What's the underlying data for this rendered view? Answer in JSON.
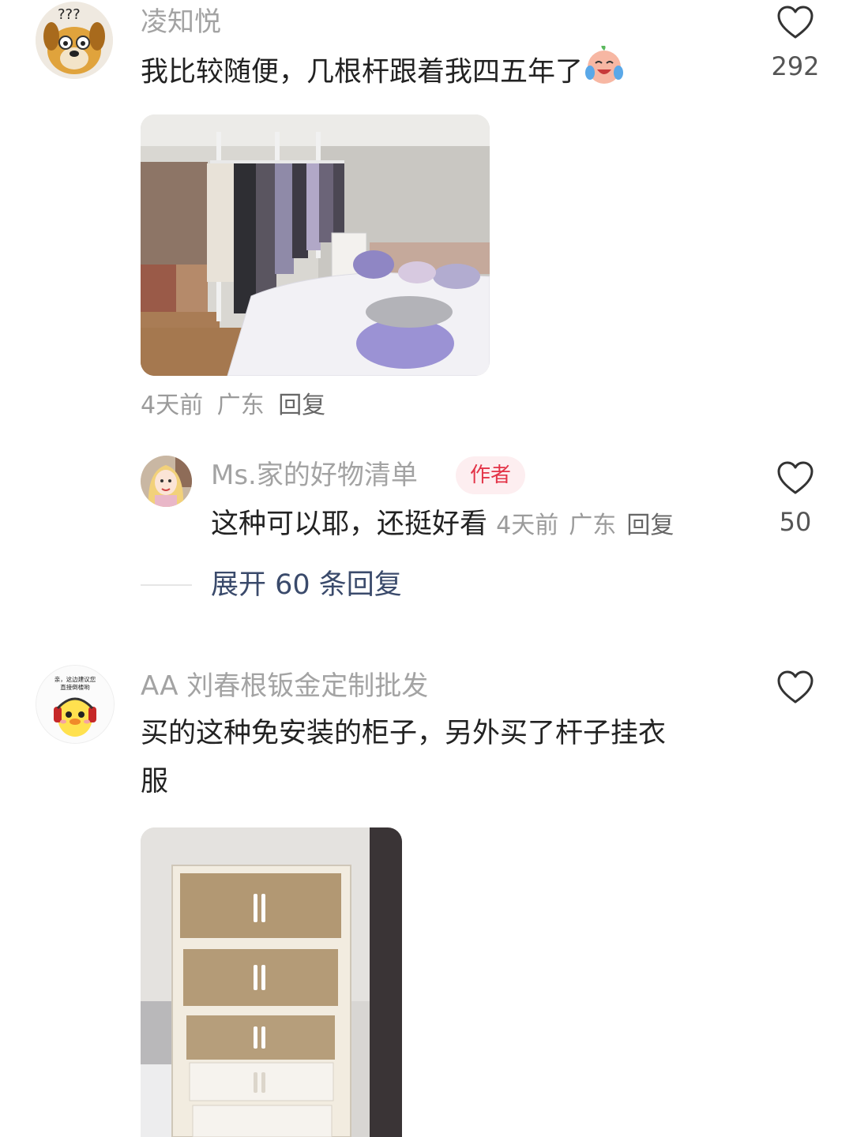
{
  "comments": [
    {
      "username": "凌知悦",
      "avatar_icon": "confused-dog-icon",
      "text": "我比较随便，几根杆跟着我四五年了",
      "emoji": "crying-laughing-emoji-icon",
      "image_desc": "bedroom-wardrobe-photo",
      "time": "4天前",
      "location": "广东",
      "reply_label": "回复",
      "likes": "292",
      "replies": [
        {
          "username": "Ms.家的好物清单",
          "avatar_icon": "girl-avatar-icon",
          "badge": "作者",
          "text": "这种可以耶，还挺好看",
          "time": "4天前",
          "location": "广东",
          "reply_label": "回复",
          "likes": "50"
        }
      ],
      "expand_label": "展开 60 条回复"
    },
    {
      "username": "AA 刘春根钣金定制批发",
      "avatar_icon": "yellow-duck-headphones-icon",
      "avatar_caption": "亲，这边建议您直接倒楼哟",
      "text_line1": "买的这种免安装的柜子，另外买了杆子挂衣",
      "text_line2": "服",
      "image_desc": "storage-cabinet-photo"
    }
  ],
  "colors": {
    "accent": "#e33448",
    "expand": "#3a4a6b",
    "meta": "#9b9b9b"
  }
}
